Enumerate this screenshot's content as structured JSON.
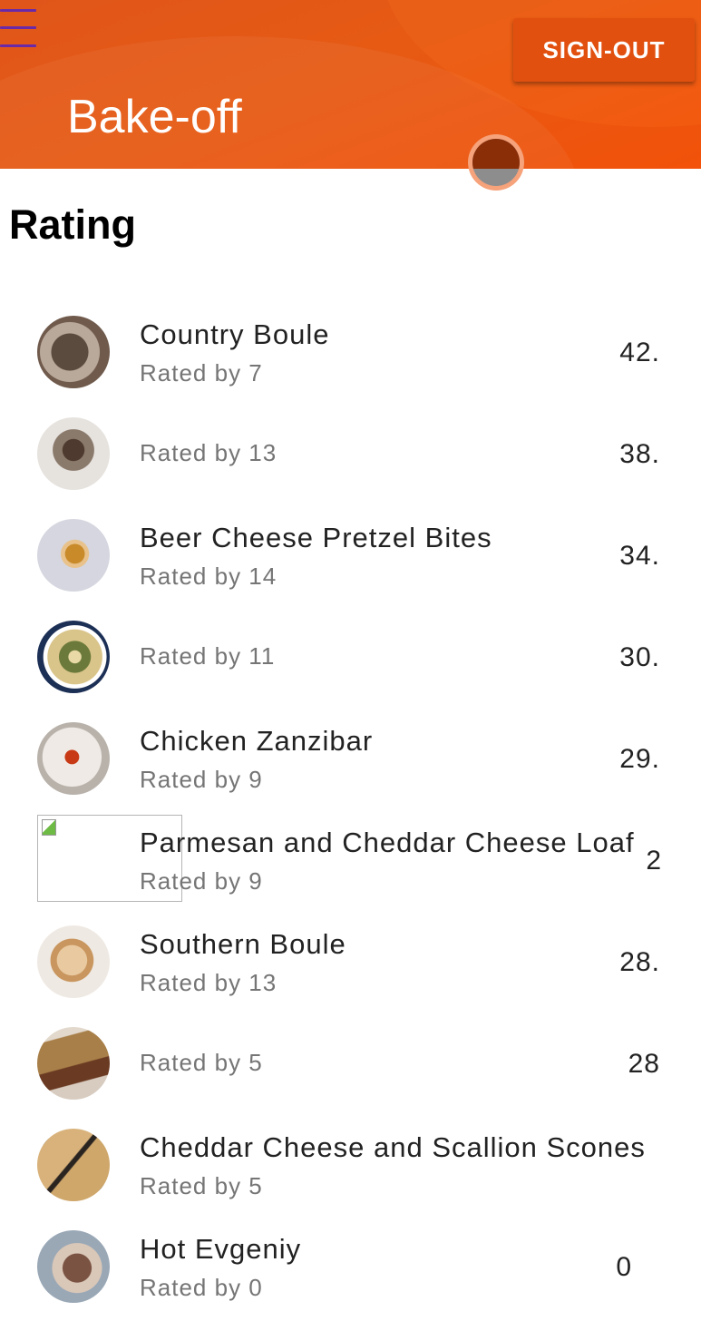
{
  "header": {
    "title": "Bake-off",
    "signout_label": "SIGN-OUT"
  },
  "page": {
    "heading": "Rating"
  },
  "items": [
    {
      "name": "Country Boule",
      "rated_by": "Rated by 7",
      "score": "42."
    },
    {
      "name": "",
      "rated_by": "Rated by 13",
      "score": "38."
    },
    {
      "name": "Beer Cheese Pretzel Bites",
      "rated_by": "Rated by 14",
      "score": "34."
    },
    {
      "name": "",
      "rated_by": "Rated by 11",
      "score": "30."
    },
    {
      "name": "Chicken Zanzibar",
      "rated_by": "Rated by 9",
      "score": "29."
    },
    {
      "name": "Parmesan and Cheddar Cheese Loaf",
      "rated_by": "Rated by 9",
      "score": "2"
    },
    {
      "name": "Southern Boule",
      "rated_by": "Rated by 13",
      "score": "28."
    },
    {
      "name": "",
      "rated_by": "Rated by 5",
      "score": "28"
    },
    {
      "name": "Cheddar Cheese and Scallion Scones",
      "rated_by": "Rated by 5",
      "score": ""
    },
    {
      "name": "Hot Evgeniy",
      "rated_by": "Rated by 0",
      "score": "0"
    }
  ],
  "icons": {
    "menu": "menu-icon",
    "fab": "avatar-fab"
  },
  "colors": {
    "header": "#e65a14",
    "menu": "#6a2aa8",
    "text": "#222222",
    "secondary": "#757575"
  }
}
